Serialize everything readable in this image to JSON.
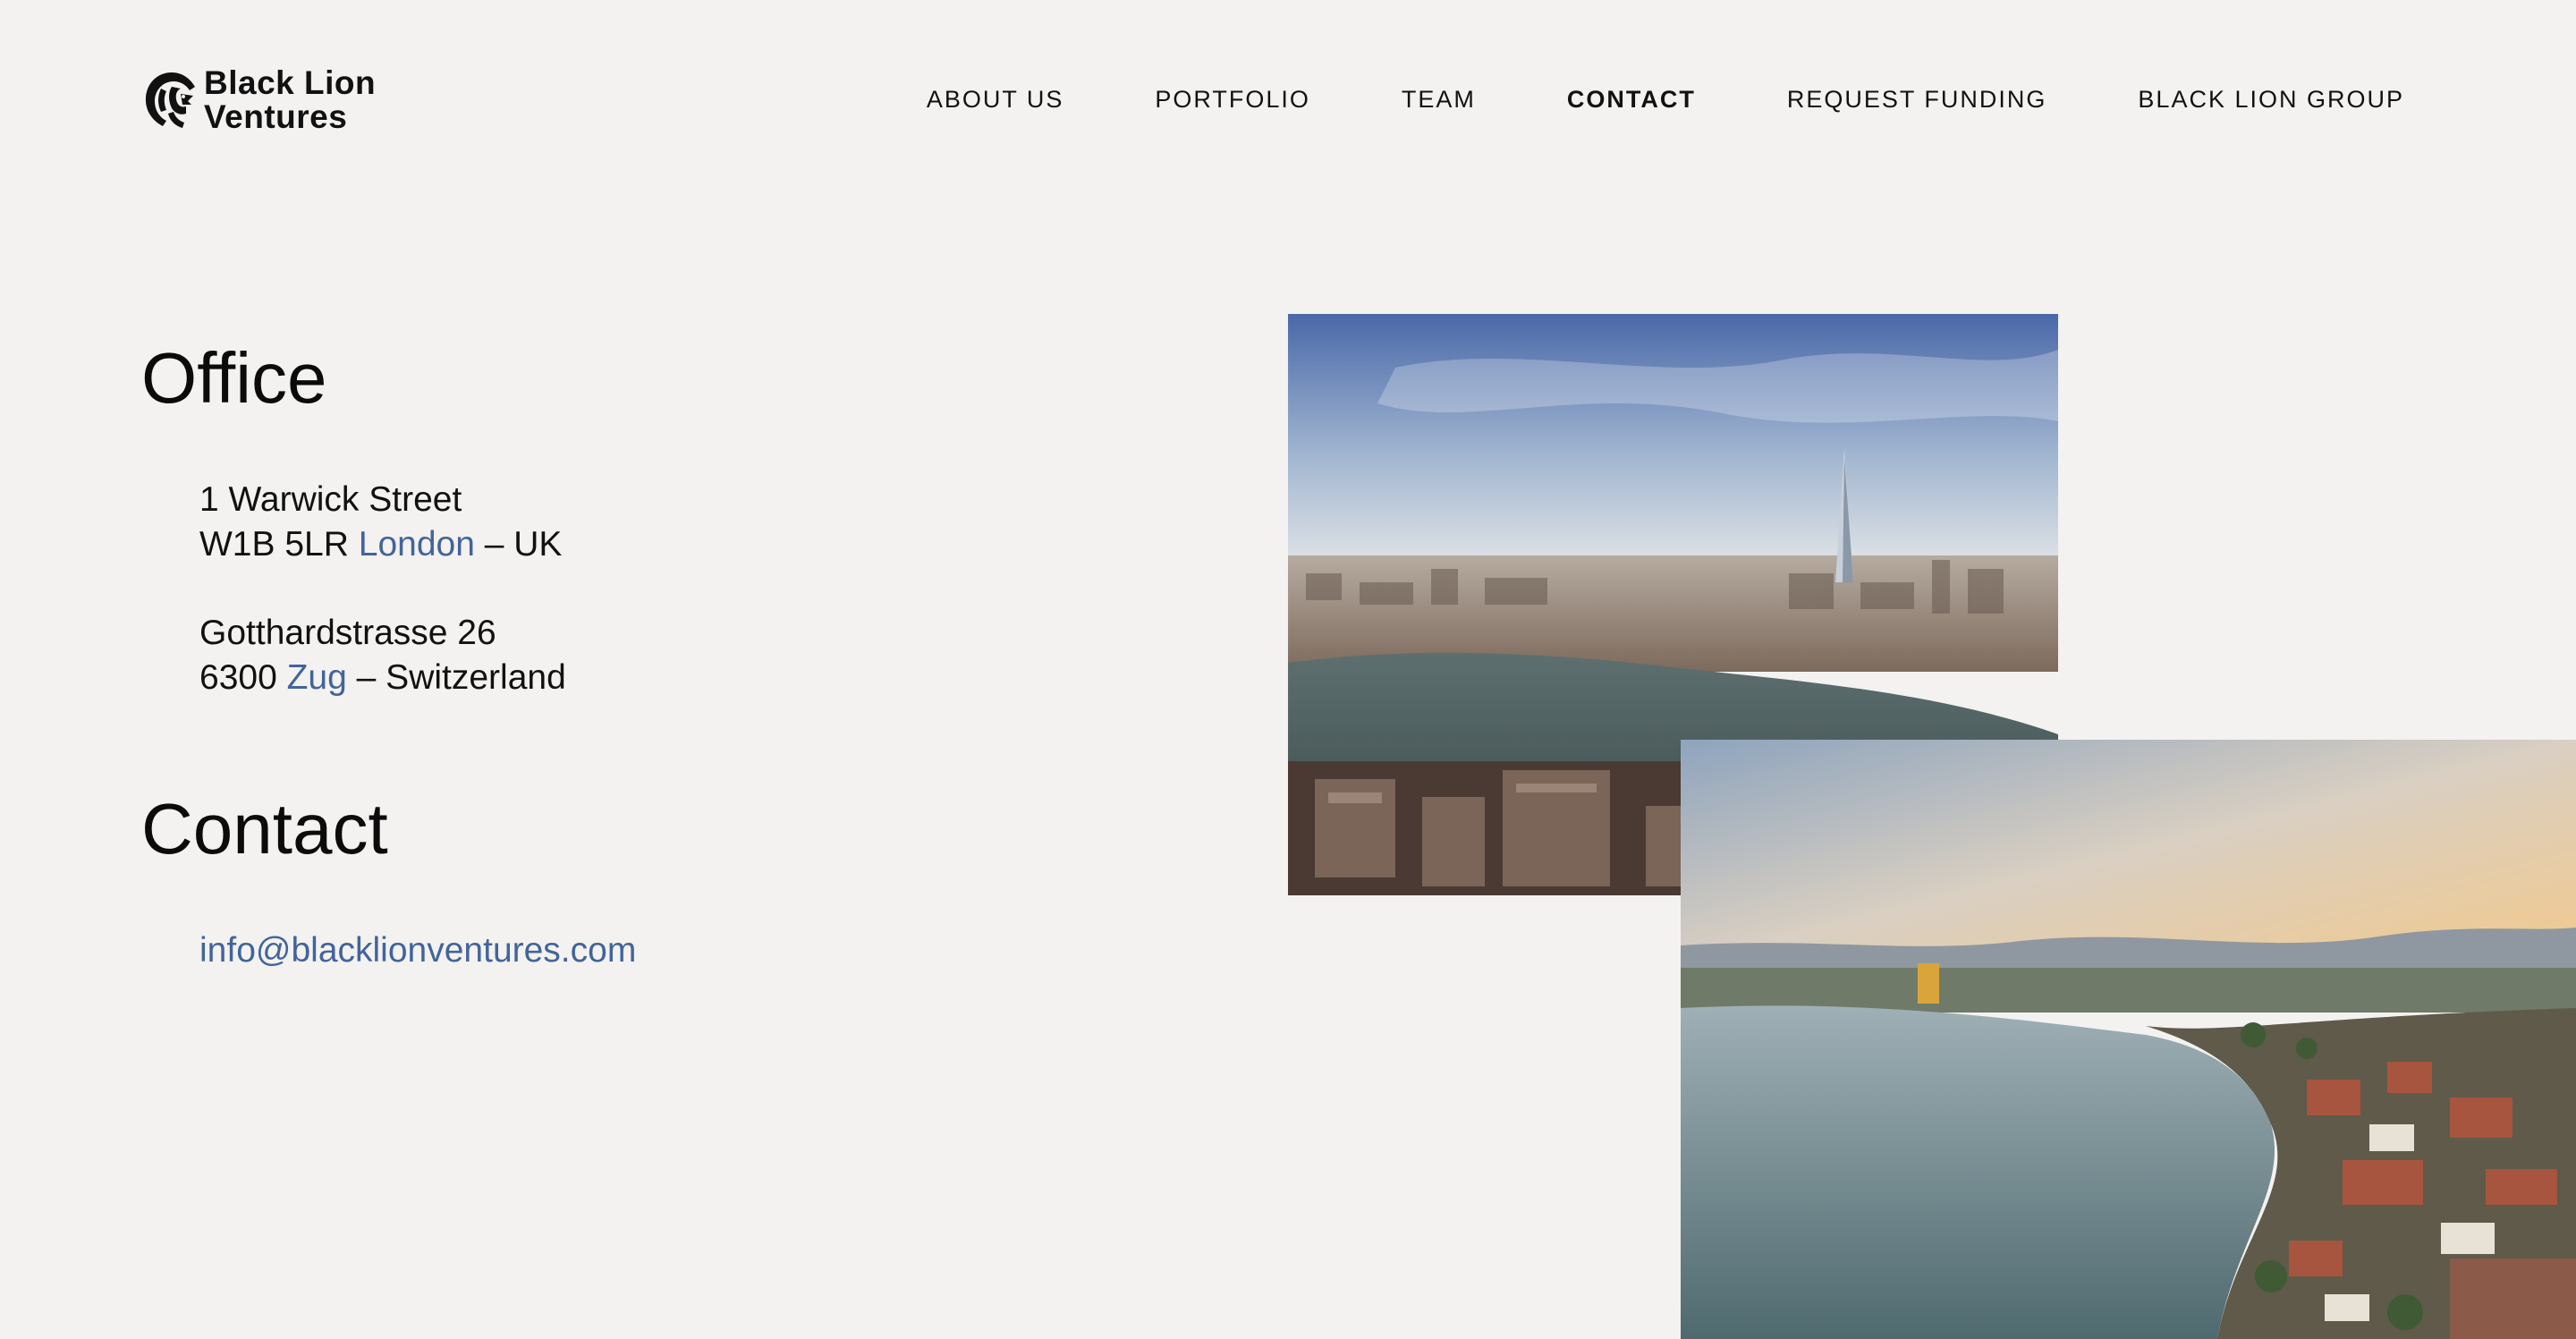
{
  "header": {
    "logo": {
      "line1": "Black Lion",
      "line2": "Ventures",
      "icon": "lion-head-icon"
    },
    "nav": [
      {
        "label": "ABOUT US",
        "active": false
      },
      {
        "label": "PORTFOLIO",
        "active": false
      },
      {
        "label": "TEAM",
        "active": false
      },
      {
        "label": "CONTACT",
        "active": true
      },
      {
        "label": "REQUEST FUNDING",
        "active": false
      },
      {
        "label": "BLACK LION GROUP",
        "active": false
      }
    ]
  },
  "office": {
    "heading": "Office",
    "london": {
      "street": "1 Warwick Street",
      "postcode": "W1B 5LR",
      "city": "London",
      "country": "– UK"
    },
    "zug": {
      "street": "Gotthardstrasse 26",
      "postcode": "6300",
      "city": "Zug",
      "country": "– Switzerland"
    }
  },
  "contact": {
    "heading": "Contact",
    "email": "info@blacklionventures.com"
  },
  "colors": {
    "background": "#f3f2f0",
    "text": "#111111",
    "link_accent": "#42649a"
  }
}
